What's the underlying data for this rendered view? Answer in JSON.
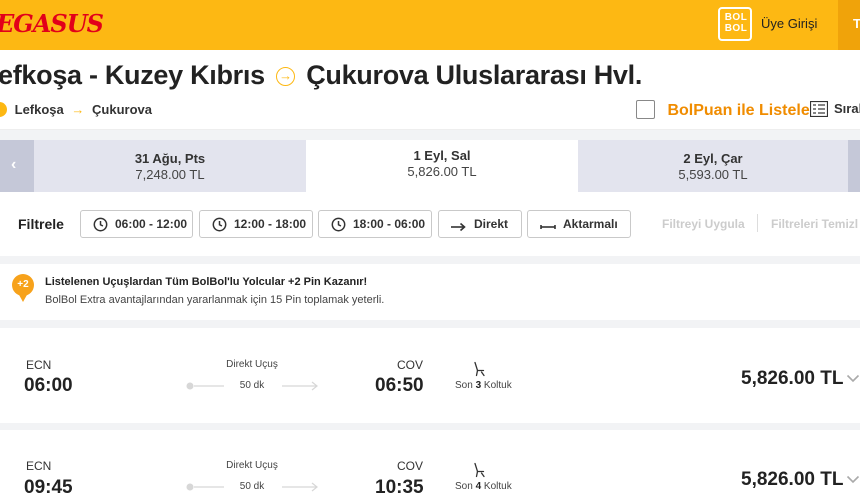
{
  "header": {
    "logo": "EGASUS",
    "bolbol_top": "BOL",
    "bolbol_bottom": "BOL",
    "member_login": "Üye Girişi",
    "right_cut": "T"
  },
  "title": {
    "origin": "efkoşa - Kuzey Kıbrıs",
    "destination": "Çukurova Uluslararası Hvl."
  },
  "subbar": {
    "from": "Lefkoşa",
    "to": "Çukurova",
    "bolpuan_label": "BolPuan ile Listele",
    "sort_label": "Sıral"
  },
  "dates": [
    {
      "date": "31 Ağu, Pts",
      "price": "7,248.00 TL"
    },
    {
      "date": "1 Eyl, Sal",
      "price": "5,826.00 TL"
    },
    {
      "date": "2 Eyl, Çar",
      "price": "5,593.00 TL"
    }
  ],
  "filters": {
    "label": "Filtrele",
    "buttons": [
      "06:00 - 12:00",
      "12:00 - 18:00",
      "18:00 - 06:00",
      "Direkt",
      "Aktarmalı"
    ],
    "apply": "Filtreyi Uygula",
    "clear": "Filtreleri Temizl"
  },
  "promo": {
    "badge": "+2",
    "title": "Listelenen Uçuşlardan Tüm BolBol'lu Yolcular +2 Pin Kazanır!",
    "text": "BolBol Extra avantajlarından yararlanmak için 15 Pin toplamak yeterli."
  },
  "flights": [
    {
      "dep_code": "ECN",
      "dep_time": "06:00",
      "type": "Direkt Uçuş",
      "duration": "50 dk",
      "arr_code": "COV",
      "arr_time": "06:50",
      "seat_prefix": "Son",
      "seats": "3",
      "seat_suffix": "Koltuk",
      "price": "5,826.00 TL"
    },
    {
      "dep_code": "ECN",
      "dep_time": "09:45",
      "type": "Direkt Uçuş",
      "duration": "50 dk",
      "arr_code": "COV",
      "arr_time": "10:35",
      "seat_prefix": "Son",
      "seats": "4",
      "seat_suffix": "Koltuk",
      "price": "5,826.00 TL"
    }
  ],
  "colors": {
    "brand_yellow": "#fdb813",
    "brand_red": "#e2001a",
    "accent_orange": "#f08c00"
  }
}
